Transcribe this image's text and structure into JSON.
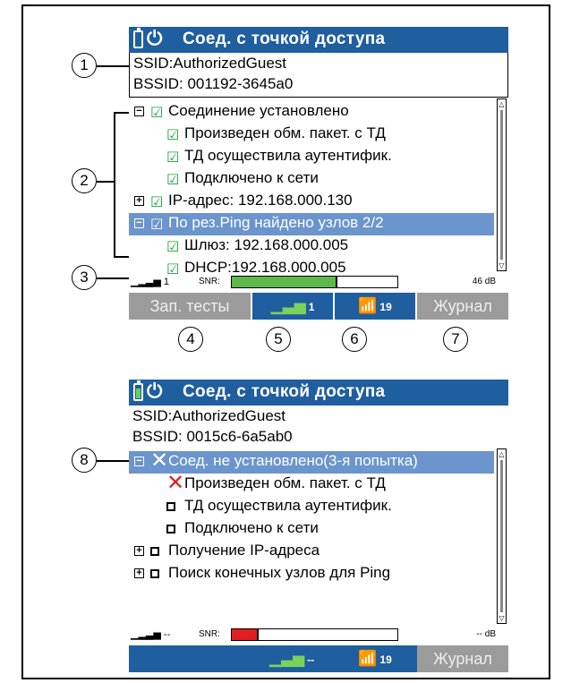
{
  "screen1": {
    "title": "Соед. с точкой доступа",
    "ssid": "SSID:AuthorizedGuest",
    "bssid": "BSSID: 001192-3645a0",
    "rows": [
      {
        "expander": "⊟",
        "mark": "check",
        "label": "Соединение установлено"
      },
      {
        "mark": "check",
        "label": "Произведен обм. пакет. с ТД"
      },
      {
        "mark": "check",
        "label": "ТД осуществила аутентифик."
      },
      {
        "mark": "check",
        "label": "Подключено к сети"
      },
      {
        "expander": "⊞",
        "mark": "check",
        "label": "IP-адрес: 192.168.000.130"
      },
      {
        "expander": "⊟",
        "mark": "check",
        "label": "По рез.Ping найдено узлов 2/2",
        "selected": true
      },
      {
        "mark": "check",
        "label": "Шлюз: 192.168.000.005"
      },
      {
        "mark": "check",
        "label": "DHCP:192.168.000.005"
      }
    ],
    "signal_text": "1",
    "snr_label": "SNR:",
    "snr_value": "46 dB",
    "snr_level_percent": 64,
    "snr_color": "#5fb84a",
    "tabs": {
      "left": "Зап. тесты",
      "signal_count": "1",
      "wifi_count": "19",
      "right": "Журнал"
    }
  },
  "screen2": {
    "title": "Соед. с точкой доступа",
    "ssid": "SSID:AuthorizedGuest",
    "bssid": "BSSID: 0015c6-6a5ab0",
    "rows": [
      {
        "expander": "⊟",
        "mark": "fail",
        "label": "Соед. не установлено(3-я попытка)",
        "selected": true
      },
      {
        "mark": "fail",
        "label": "Произведен обм. пакет. с ТД"
      },
      {
        "mark": "box",
        "label": "ТД осуществила аутентифик."
      },
      {
        "mark": "box",
        "label": "Подключено к сети"
      },
      {
        "expander": "⊞",
        "mark": "box",
        "label": "Получение IP-адреса"
      },
      {
        "expander": "⊞",
        "mark": "box",
        "label": "Поиск конечных узлов для Ping"
      }
    ],
    "signal_text": "--",
    "snr_label": "SNR:",
    "snr_value": "-- dB",
    "snr_level_percent": 16,
    "snr_color": "#e02020",
    "tabs": {
      "left": "",
      "signal_count": "--",
      "wifi_count": "19",
      "right": "Журнал"
    }
  },
  "callouts": [
    "1",
    "2",
    "3",
    "4",
    "5",
    "6",
    "7",
    "8"
  ],
  "colors": {
    "title_bar": "#1f5e9f",
    "selected_row": "#6b95cc",
    "tab_grey": "#9b9b9b",
    "check": "#1aa33b",
    "fail": "#e02020"
  }
}
